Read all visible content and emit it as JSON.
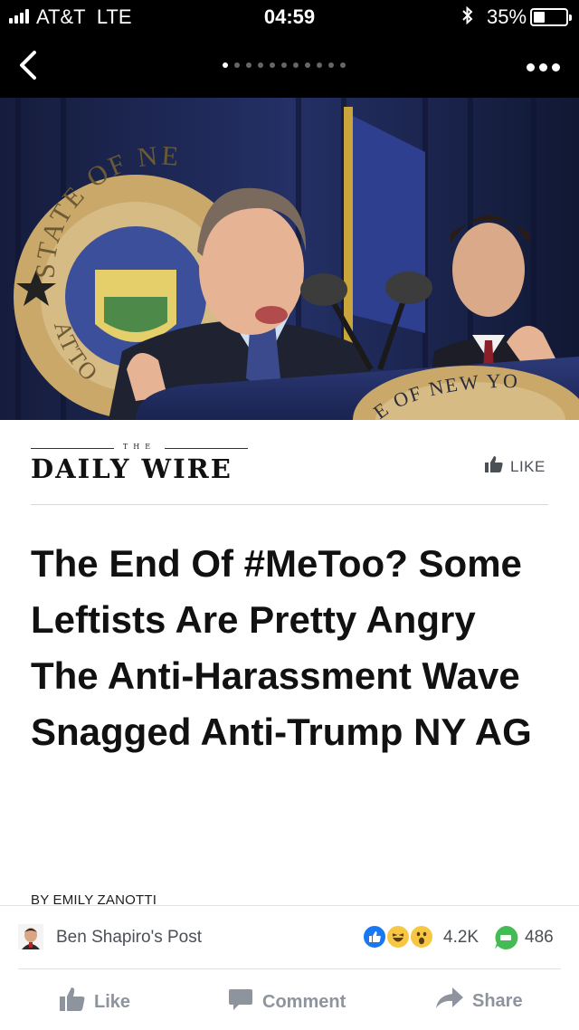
{
  "status_bar": {
    "carrier": "AT&T",
    "network": "LTE",
    "time": "04:59",
    "battery_percent": "35%",
    "battery_level": 0.35,
    "icons": [
      "signal-icon",
      "bluetooth-icon",
      "battery-icon"
    ]
  },
  "nav": {
    "back_icon": "chevron-left-icon",
    "page_dots_count": 11,
    "active_page_index": 0,
    "more_icon": "ellipsis-icon"
  },
  "publisher": {
    "logo_small_text": "THE",
    "logo_name": "DAILY WIRE",
    "like_label": "LIKE"
  },
  "article": {
    "headline": "The End Of #MeToo? Some Leftists Are Pretty Angry The Anti-Harassment Wave Snagged Anti-Trump NY AG",
    "byline": "BY EMILY ZANOTTI",
    "image_seal_text_top": "STATE OF NE",
    "image_seal_text_side": "ATTO",
    "image_podium_text": "E OF NEW YO"
  },
  "post": {
    "source": "Ben Shapiro's Post",
    "reaction_count": "4.2K",
    "comment_count": "486",
    "reactions": [
      "like-reaction-icon",
      "haha-reaction-icon",
      "wow-reaction-icon"
    ]
  },
  "actions": {
    "like": "Like",
    "comment": "Comment",
    "share": "Share"
  },
  "colors": {
    "bar_background": "#000000",
    "action_text": "#8d949e",
    "facebook_blue": "#1877f2",
    "messenger_green": "#44bb55"
  }
}
